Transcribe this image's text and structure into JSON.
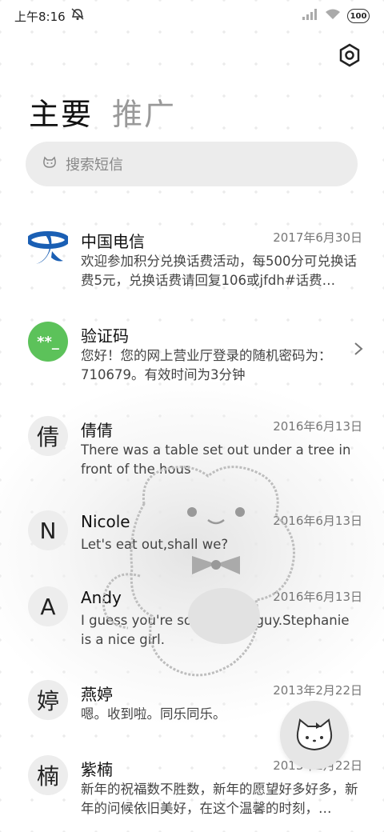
{
  "status_bar": {
    "time": "上午8:16",
    "battery": "100"
  },
  "tabs": [
    {
      "label": "主要",
      "active": true
    },
    {
      "label": "推广",
      "active": false
    }
  ],
  "search": {
    "placeholder": "搜索短信"
  },
  "messages": [
    {
      "avatar": "telecom-logo",
      "name": "中国电信",
      "date": "2017年6月30日",
      "body": "欢迎参加积分兑换话费活动，每500分可兑换话费5元，兑换话费请回复106或jfdh#话费…"
    },
    {
      "avatar_text": "**_",
      "name": "验证码",
      "date": "",
      "body": "您好！您的网上营业厅登录的随机密码为：710679。有效时间为3分钟"
    },
    {
      "avatar_text": "倩",
      "name": "倩倩",
      "date": "2016年6月13日",
      "body": "There was a table set out under a tree in front of the hous"
    },
    {
      "avatar_text": "N",
      "name": "Nicole",
      "date": "2016年6月13日",
      "body": "Let's eat out,shall we?"
    },
    {
      "avatar_text": "A",
      "name": "Andy",
      "date": "2016年6月13日",
      "body": "I guess you're some lucky guy.Stephanie is a nice girl."
    },
    {
      "avatar_text": "婷",
      "name": "燕婷",
      "date": "2013年2月22日",
      "body": "嗯。收到啦。同乐同乐。"
    },
    {
      "avatar_text": "楠",
      "name": "紫楠",
      "date": "2013年2月22日",
      "body": "新年的祝福数不胜数，新年的愿望好多好多，新年的问候依旧美好，在这个温馨的时刻，…"
    }
  ],
  "colors": {
    "accent_green": "#5cc25a",
    "telecom_blue": "#1a5fb4"
  }
}
